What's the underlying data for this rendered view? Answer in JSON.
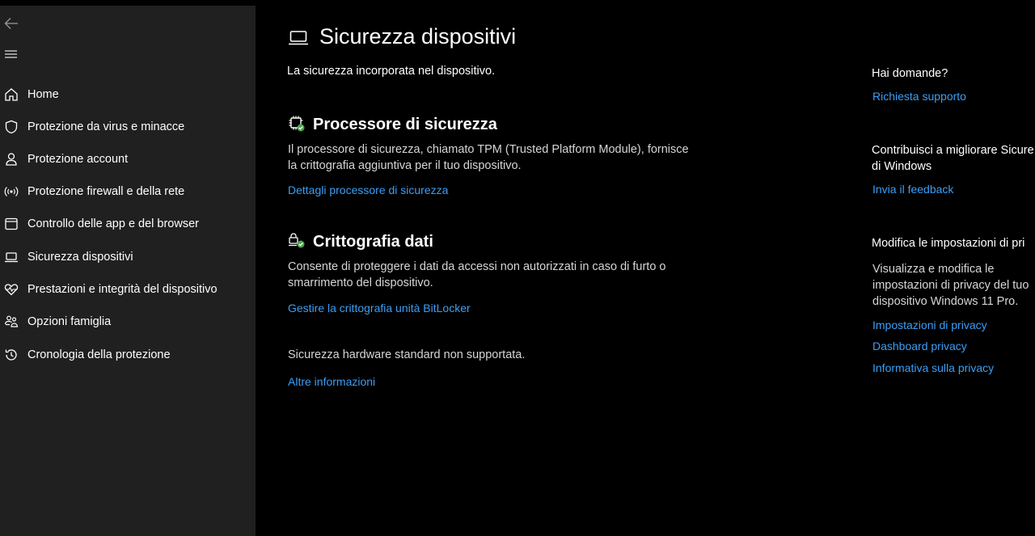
{
  "sidebar": {
    "back_icon": "arrow-left-icon",
    "menu_icon": "hamburger-icon",
    "items": [
      {
        "label": "Home",
        "icon": "home-icon"
      },
      {
        "label": "Protezione da virus e minacce",
        "icon": "shield-icon"
      },
      {
        "label": "Protezione account",
        "icon": "person-icon"
      },
      {
        "label": "Protezione firewall e della rete",
        "icon": "antenna-icon"
      },
      {
        "label": "Controllo delle app e del browser",
        "icon": "app-window-icon"
      },
      {
        "label": "Sicurezza dispositivi",
        "icon": "laptop-icon"
      },
      {
        "label": "Prestazioni e integrità del dispositivo",
        "icon": "heart-pulse-icon"
      },
      {
        "label": "Opzioni famiglia",
        "icon": "family-icon"
      },
      {
        "label": "Cronologia della protezione",
        "icon": "history-icon"
      }
    ]
  },
  "main": {
    "title": "Sicurezza dispositivi",
    "subtitle": "La sicurezza incorporata nel dispositivo.",
    "processor": {
      "title": "Processore di sicurezza",
      "description": "Il processore di sicurezza, chiamato TPM (Trusted Platform Module), fornisce la crittografia aggiuntiva per il tuo dispositivo.",
      "link": "Dettagli processore di sicurezza"
    },
    "encryption": {
      "title": "Crittografia dati",
      "description": "Consente di proteggere i dati da accessi non autorizzati in caso di furto o smarrimento del dispositivo.",
      "link": "Gestire la crittografia unità BitLocker"
    },
    "hardware_note": "Sicurezza hardware standard non supportata.",
    "more_info_link": "Altre informazioni"
  },
  "right": {
    "questions_title": "Hai domande?",
    "support_link": "Richiesta supporto",
    "improve_title_line1": "Contribuisci a migliorare Sicure",
    "improve_title_line2": "di Windows",
    "feedback_link": "Invia il feedback",
    "privacy_title": "Modifica le impostazioni di pri",
    "privacy_description": "Visualizza e modifica le impostazioni di privacy del tuo dispositivo Windows 11 Pro.",
    "privacy_settings_link": "Impostazioni di privacy",
    "privacy_dashboard_link": "Dashboard privacy",
    "privacy_statement_link": "Informativa sulla privacy"
  },
  "colors": {
    "sidebar_bg": "#202020",
    "main_bg": "#000000",
    "link": "#3c9ef5",
    "check_green": "#4ca64c"
  }
}
